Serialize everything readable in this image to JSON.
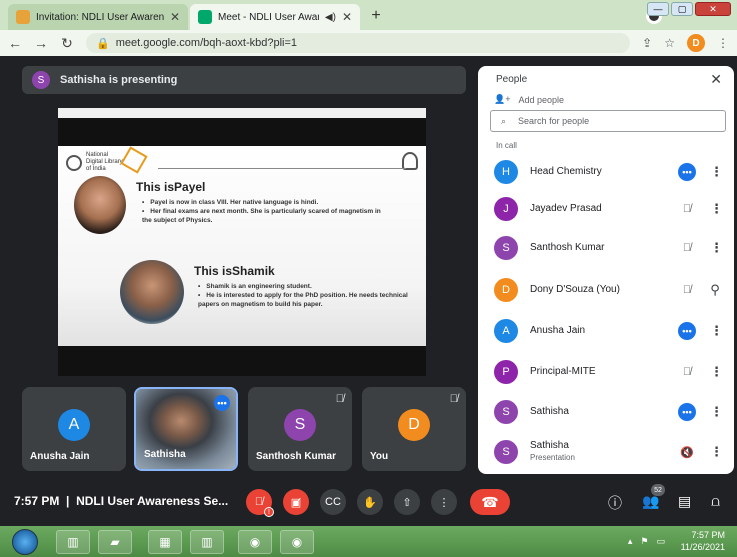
{
  "browser": {
    "tabs": [
      {
        "title": "Invitation: NDLI User Awareness",
        "active": false
      },
      {
        "title": "Meet - NDLI User Awareness",
        "active": true
      }
    ],
    "url": "meet.google.com/bqh-aoxt-kbd?pli=1",
    "profile_initial": "D"
  },
  "meet": {
    "presenting_initial": "S",
    "presenting_text": "Sathisha is presenting",
    "slide": {
      "logo_text": "National Digital Library of India",
      "heading_1": "This isPayel",
      "bullets_1": [
        "Payel is now in class VIII. Her native language is hindi.",
        "Her final exams are next month. She is particularly scared of magnetism in the subject of Physics."
      ],
      "heading_2": "This isShamik",
      "bullets_2": [
        "Shamik is an engineering student.",
        "He is interested to apply for the PhD position. He needs technical papers on magnetism to build his paper."
      ]
    },
    "tiles": [
      {
        "name": "Anusha Jain",
        "initial": "A",
        "color": "#1e88e5"
      },
      {
        "name": "Sathisha",
        "video": true
      },
      {
        "name": "Santhosh Kumar",
        "initial": "S",
        "color": "#8e44ad"
      },
      {
        "name": "You",
        "initial": "D",
        "color": "#f28c1e"
      }
    ],
    "meeting_time": "7:57 PM",
    "meeting_name": "NDLI User Awareness Se...",
    "participant_count": "52"
  },
  "people": {
    "title": "People",
    "add_people": "Add people",
    "search_placeholder": "Search for people",
    "section": "In call",
    "list": [
      {
        "initial": "H",
        "name": "Head Chemistry",
        "color": "#1e88e5",
        "status": "talking"
      },
      {
        "initial": "J",
        "name": "Jayadev Prasad",
        "color": "#8e24aa",
        "status": "muted"
      },
      {
        "initial": "S",
        "name": "Santhosh Kumar",
        "color": "#8e44ad",
        "status": "muted"
      },
      {
        "initial": "D",
        "name": "Dony D'Souza (You)",
        "color": "#f28c1e",
        "status": "muted-self"
      },
      {
        "initial": "A",
        "name": "Anusha Jain",
        "color": "#1e88e5",
        "status": "talking"
      },
      {
        "initial": "P",
        "name": "Principal-MITE",
        "color": "#8e24aa",
        "status": "muted"
      },
      {
        "initial": "S",
        "name": "Sathisha",
        "color": "#8e44ad",
        "status": "talking"
      },
      {
        "initial": "S",
        "name": "Sathisha",
        "sub": "Presentation",
        "color": "#8e44ad",
        "status": "presentation"
      }
    ]
  },
  "taskbar": {
    "time": "7:57 PM",
    "date": "11/26/2021"
  },
  "colors": {
    "meet_bg": "#202124",
    "accent_blue": "#1a73e8",
    "danger_red": "#ea4335",
    "tab_strip": "#cfe3c6"
  }
}
